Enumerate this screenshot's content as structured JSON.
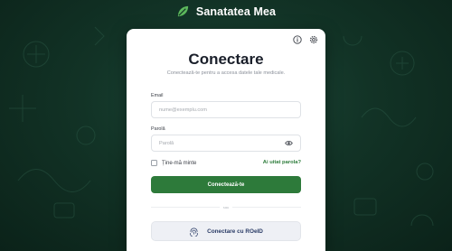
{
  "brand": {
    "name": "Sanatatea Mea"
  },
  "icons": {
    "logo": "leaf-logo-icon",
    "info": "info-circle-icon",
    "settings": "gear-icon",
    "password_toggle": "eye-icon",
    "roeid": "fingerprint-icon"
  },
  "login": {
    "title": "Conectare",
    "subtitle": "Conectează-te pentru a accesa datele tale medicale.",
    "email_label": "Email",
    "email_placeholder": "nume@exemplu.com",
    "email_value": "",
    "password_label": "Parolă",
    "password_placeholder": "Parolă",
    "password_value": "",
    "remember_label": "Ține-mă minte",
    "remember_checked": false,
    "forgot_label": "Ai uitat parola?",
    "submit_label": "Conectează-te",
    "divider_label": "sau",
    "roeid_label": "Conectare cu ROeID"
  },
  "colors": {
    "background": "#123326",
    "primary": "#2d7a3a",
    "link": "#2e7d3c",
    "card": "#ffffff",
    "roeid_text": "#2a3b66"
  }
}
